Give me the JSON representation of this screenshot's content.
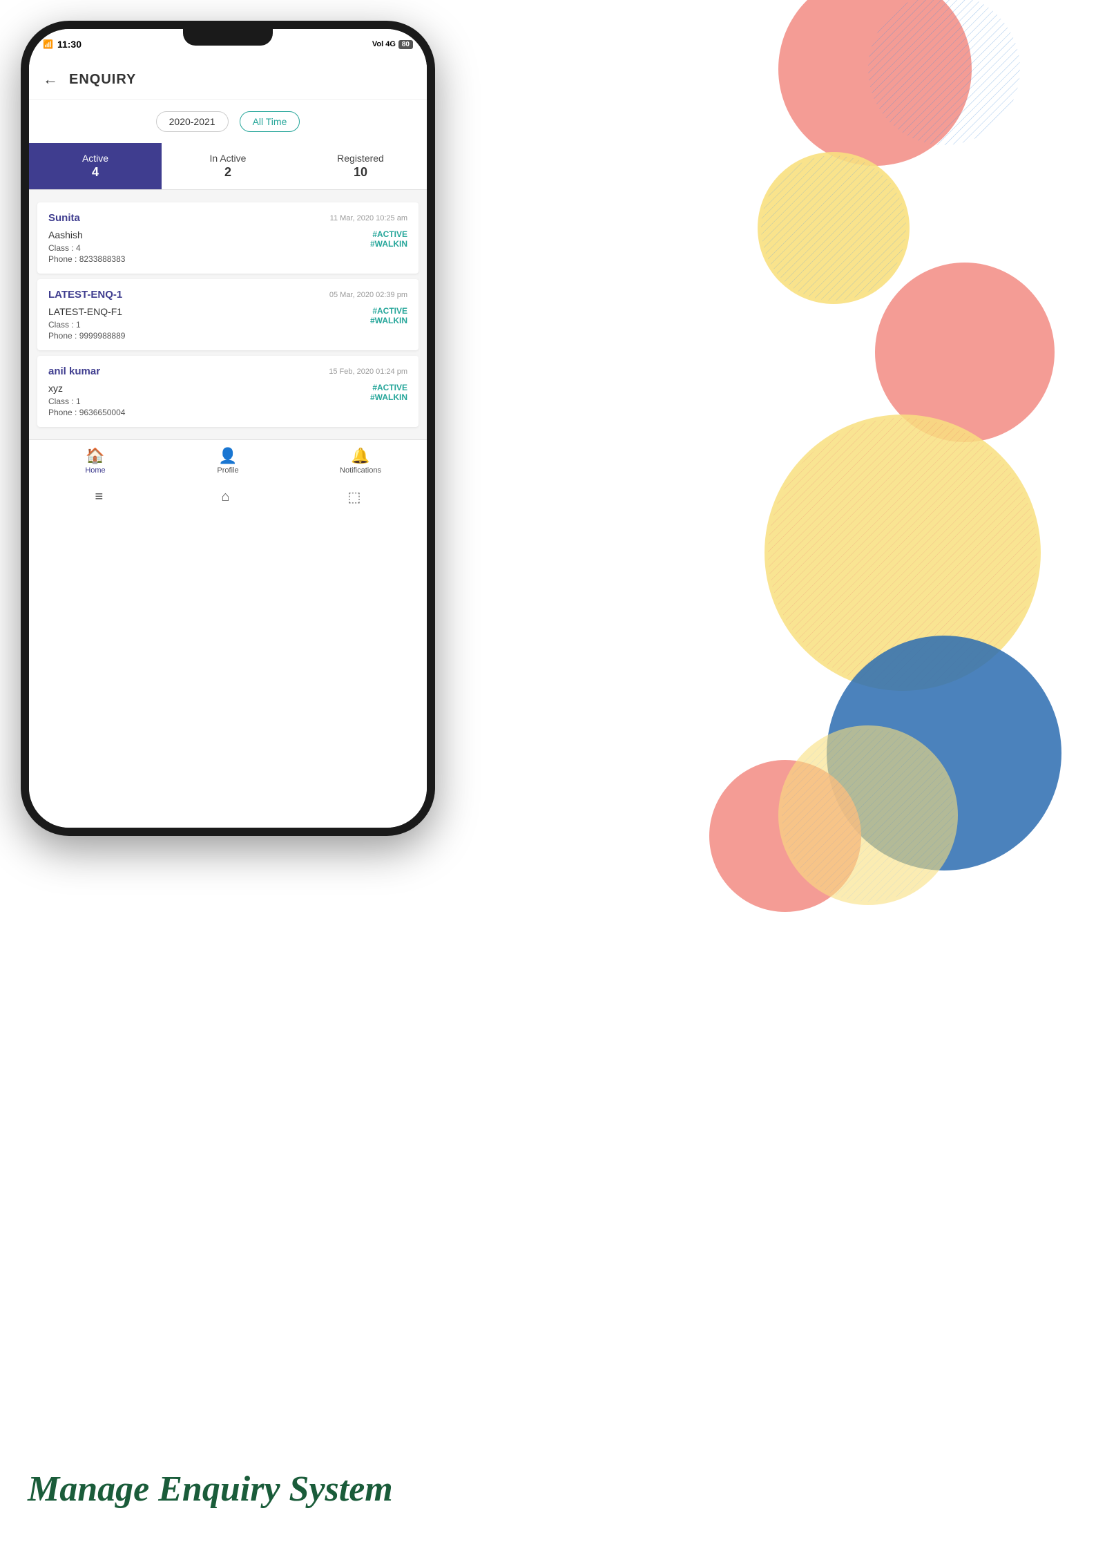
{
  "header": {
    "title": "ENQUIRY",
    "back_label": "←"
  },
  "status_bar": {
    "time": "11:30",
    "signal": "4G",
    "battery": "80"
  },
  "filters": {
    "year": "2020-2021",
    "time_filter": "All Time"
  },
  "tabs": [
    {
      "label": "Active",
      "count": "4",
      "active": true
    },
    {
      "label": "In Active",
      "count": "2",
      "active": false
    },
    {
      "label": "Registered",
      "count": "10",
      "active": false
    }
  ],
  "enquiries": [
    {
      "name": "Sunita",
      "date": "11 Mar, 2020 10:25 am",
      "sub_name": "Aashish",
      "class": "4",
      "phone": "8233888383",
      "tag1": "#ACTIVE",
      "tag2": "#WALKIN"
    },
    {
      "name": "LATEST-ENQ-1",
      "date": "05 Mar, 2020 02:39 pm",
      "sub_name": "LATEST-ENQ-F1",
      "class": "1",
      "phone": "9999988889",
      "tag1": "#ACTIVE",
      "tag2": "#WALKIN"
    },
    {
      "name": "anil kumar",
      "date": "15 Feb, 2020 01:24 pm",
      "sub_name": "xyz",
      "class": "1",
      "phone": "9636650004",
      "tag1": "#ACTIVE",
      "tag2": "#WALKIN"
    }
  ],
  "bottom_nav": [
    {
      "label": "Home",
      "icon": "🏠",
      "active": true
    },
    {
      "label": "Profile",
      "icon": "👤",
      "active": false
    },
    {
      "label": "Notifications",
      "icon": "🔔",
      "active": false
    }
  ],
  "android_nav": {
    "menu_icon": "≡",
    "home_icon": "⌂",
    "back_icon": "⬚"
  },
  "tagline": "Manage Enquiry System",
  "labels": {
    "class_prefix": "Class : ",
    "phone_prefix": "Phone : "
  }
}
